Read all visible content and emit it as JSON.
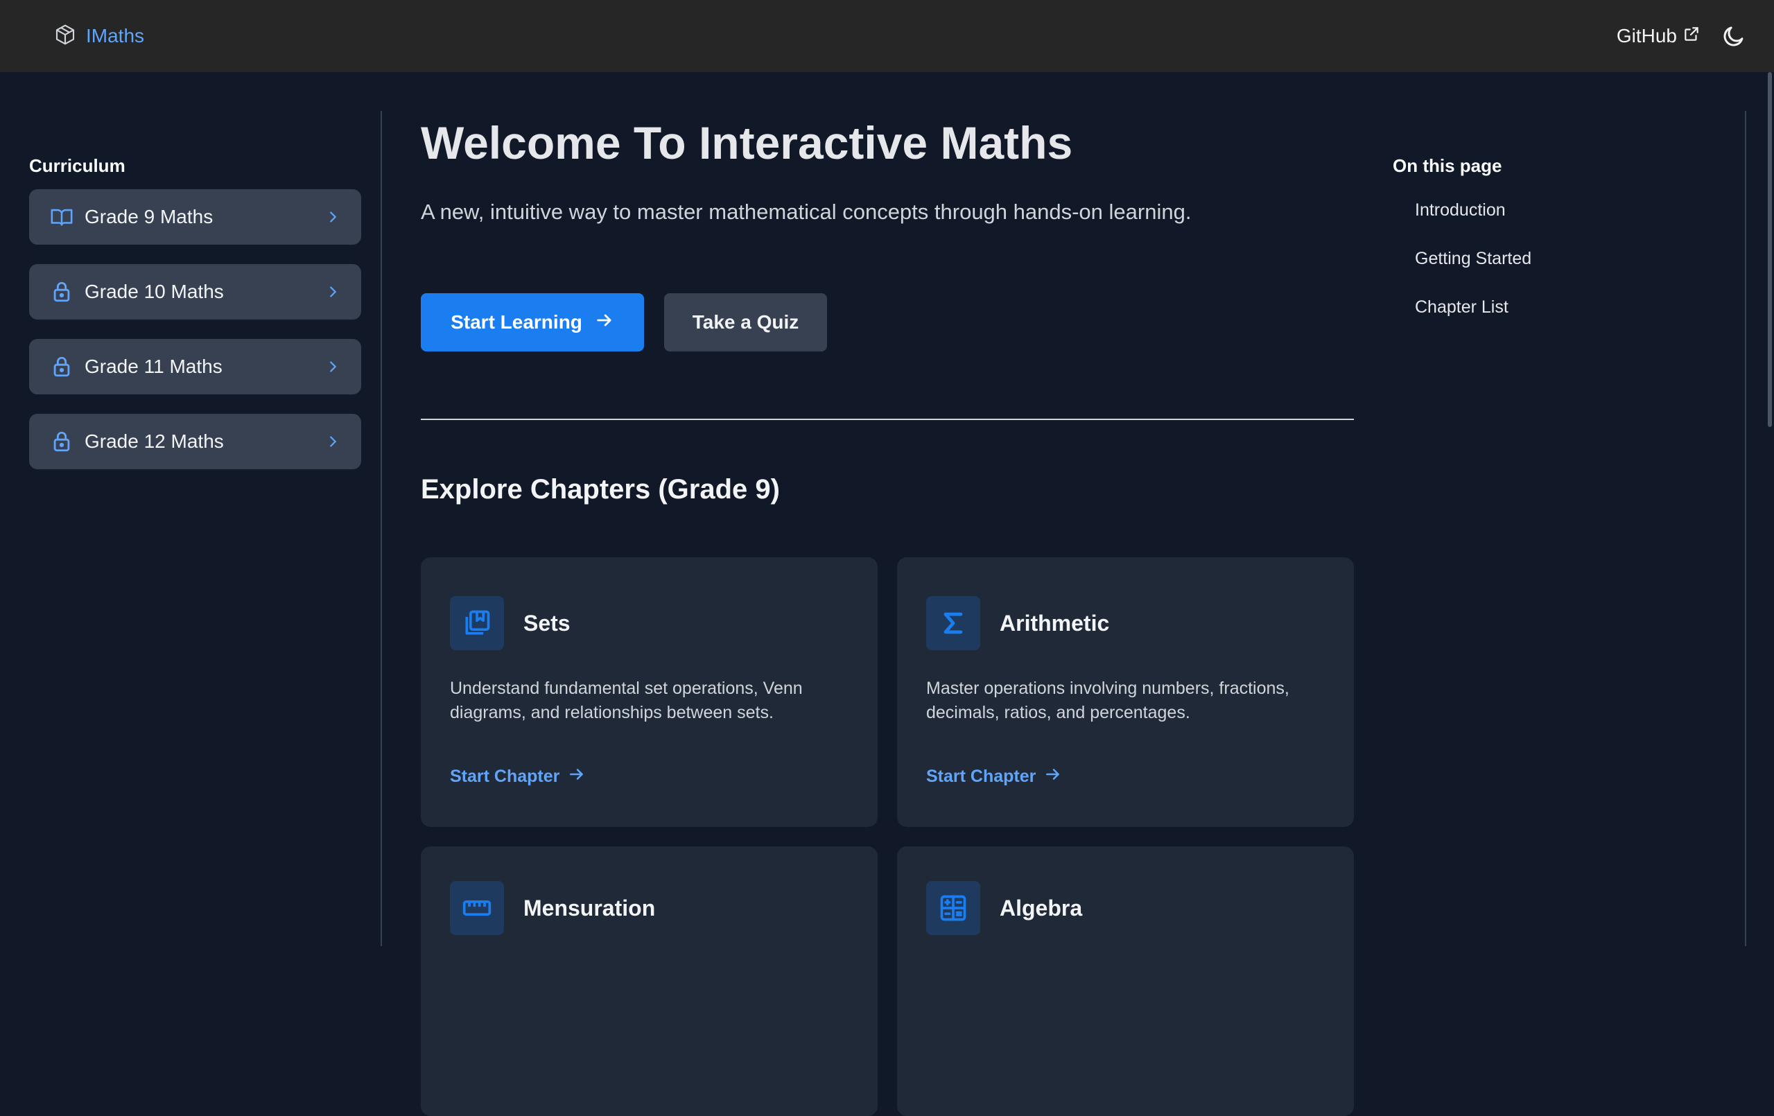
{
  "header": {
    "brand": "IMaths",
    "github_label": "GitHub"
  },
  "sidebar": {
    "title": "Curriculum",
    "items": [
      {
        "label": "Grade 9 Maths",
        "icon": "book-open-icon"
      },
      {
        "label": "Grade 10 Maths",
        "icon": "lock-icon"
      },
      {
        "label": "Grade 11 Maths",
        "icon": "lock-icon"
      },
      {
        "label": "Grade 12 Maths",
        "icon": "lock-icon"
      }
    ]
  },
  "main": {
    "title": "Welcome To Interactive Maths",
    "subtitle": "A new, intuitive way to master mathematical concepts through hands-on learning.",
    "primary_button": "Start Learning",
    "secondary_button": "Take a Quiz",
    "section_title": "Explore Chapters (Grade 9)",
    "chapters": [
      {
        "title": "Sets",
        "icon": "books-icon",
        "description": "Understand fundamental set operations, Venn diagrams, and relationships between sets.",
        "link": "Start Chapter"
      },
      {
        "title": "Arithmetic",
        "icon": "sigma-icon",
        "description": "Master operations involving numbers, fractions, decimals, ratios, and percentages.",
        "link": "Start Chapter"
      },
      {
        "title": "Mensuration",
        "icon": "ruler-icon",
        "description": "",
        "link": ""
      },
      {
        "title": "Algebra",
        "icon": "calculator-icon",
        "description": "",
        "link": ""
      }
    ]
  },
  "toc": {
    "title": "On this page",
    "items": [
      "Introduction",
      "Getting Started",
      "Chapter List"
    ]
  },
  "colors": {
    "background": "#111827",
    "header": "#262626",
    "accent": "#1a7ef0",
    "link": "#60a5fa",
    "card": "#1f2937"
  }
}
